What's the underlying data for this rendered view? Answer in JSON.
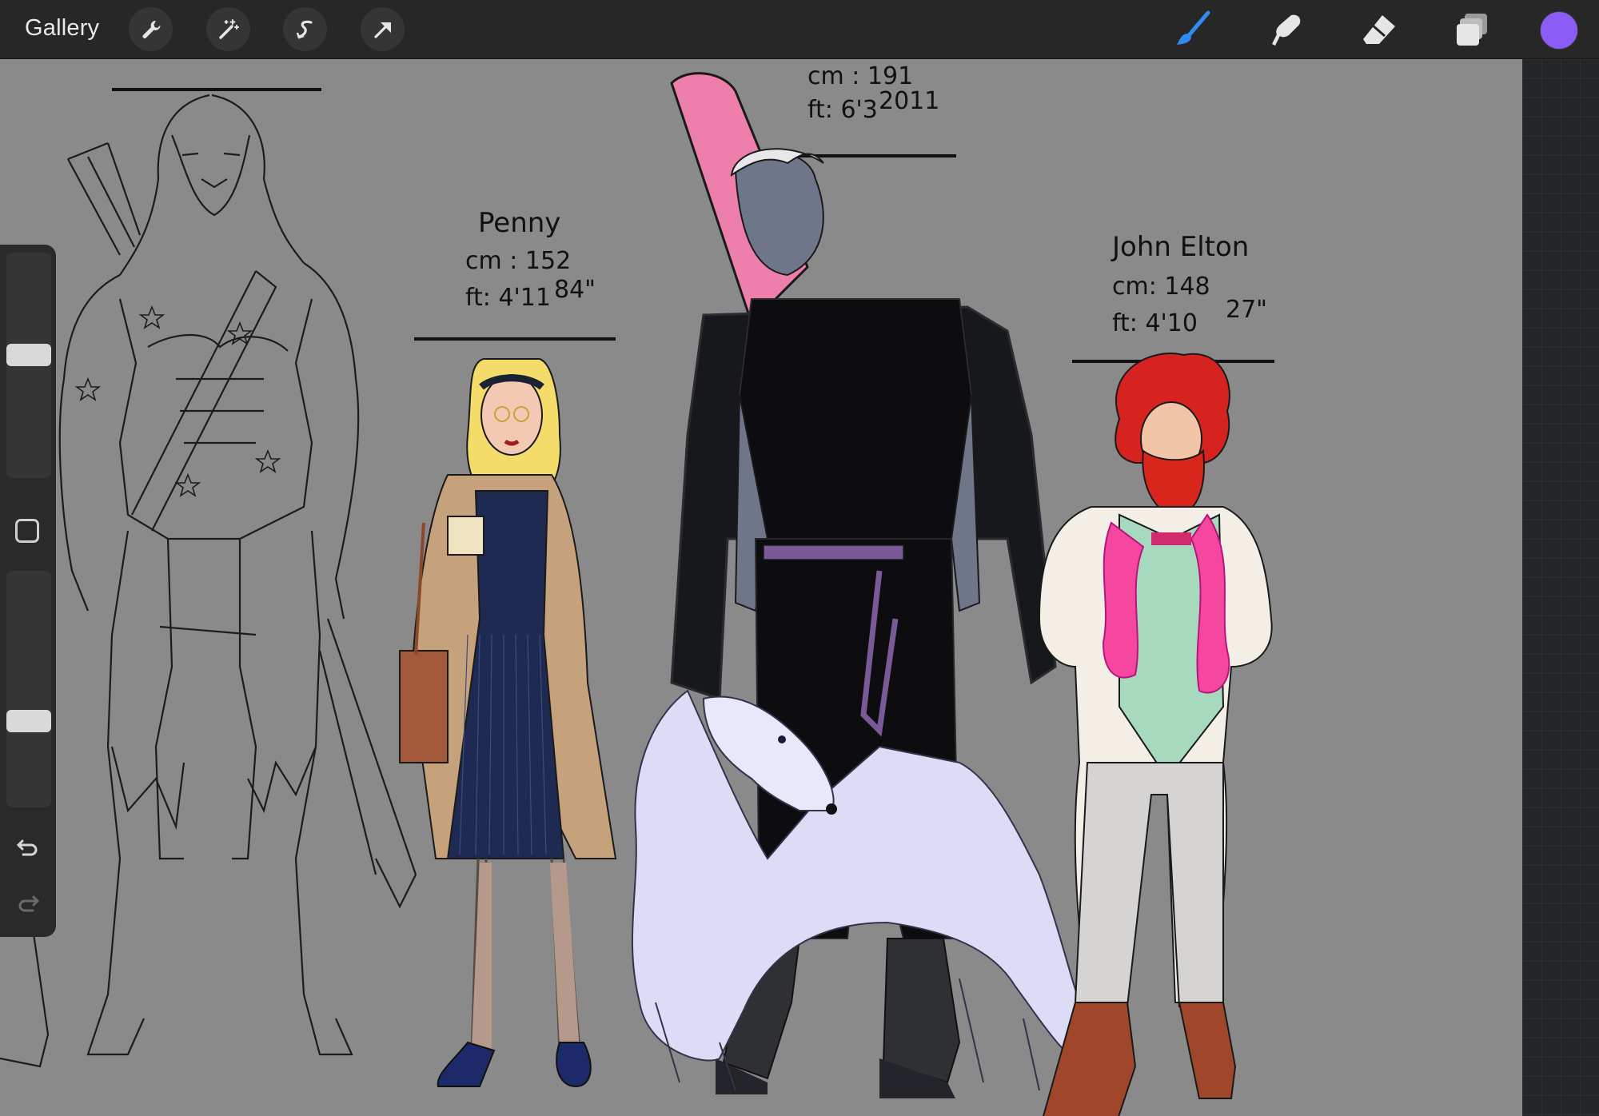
{
  "toolbar": {
    "gallery_label": "Gallery",
    "left_tools": [
      "wrench-icon",
      "magic-wand-icon",
      "selection-s-icon",
      "transform-arrow-icon"
    ],
    "right_tools": [
      "brush-icon",
      "smudge-icon",
      "eraser-icon",
      "layers-icon"
    ],
    "active_tool": "brush-icon",
    "accent": "#2f8bf0",
    "current_color": "#8b5cf6"
  },
  "sidebar": {
    "brush_size": 0.45,
    "opacity": 0.65,
    "controls": [
      "modify-button",
      "undo-icon",
      "redo-icon"
    ]
  },
  "artwork": {
    "canvas_color": "#8a8a8a",
    "penny": {
      "name": "Penny",
      "cm": "cm : 152",
      "ft": "ft: 4'11",
      "ft_sup": "84\""
    },
    "tall": {
      "cm": "cm : 191",
      "ft": "ft: 6'3",
      "ft_sup": "2011"
    },
    "john": {
      "name": "John Elton",
      "cm": "cm: 148",
      "ft": "ft: 4'10",
      "ft_sup": "27\""
    }
  }
}
